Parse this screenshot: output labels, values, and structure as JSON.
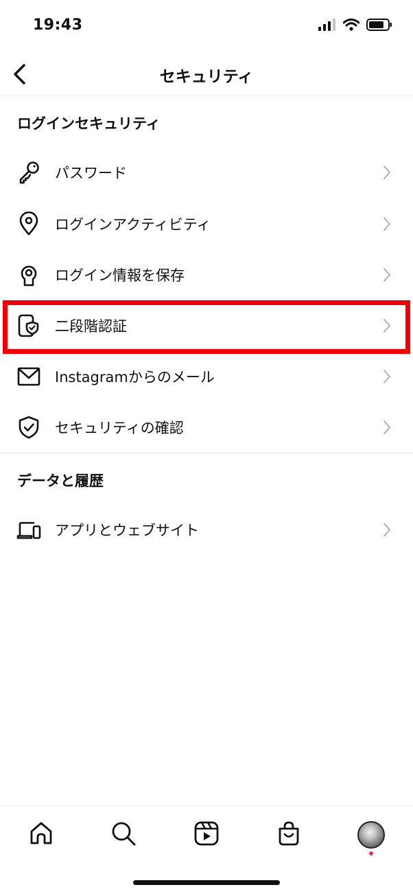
{
  "status_bar": {
    "time": "19:43",
    "icons": [
      "signal-icon",
      "wifi-icon",
      "battery-icon"
    ]
  },
  "header": {
    "title": "セキュリティ",
    "back_icon": "chevron-left-icon"
  },
  "sections": [
    {
      "title": "ログインセキュリティ",
      "items": [
        {
          "label": "パスワード",
          "icon": "key-icon"
        },
        {
          "label": "ログインアクティビティ",
          "icon": "location-pin-icon"
        },
        {
          "label": "ログイン情報を保存",
          "icon": "keyhole-icon"
        },
        {
          "label": "二段階認証",
          "icon": "device-shield-icon",
          "highlighted": true
        },
        {
          "label": "Instagramからのメール",
          "icon": "envelope-icon"
        },
        {
          "label": "セキュリティの確認",
          "icon": "shield-check-icon"
        }
      ]
    },
    {
      "title": "データと履歴",
      "items": [
        {
          "label": "アプリとウェブサイト",
          "icon": "devices-icon"
        }
      ]
    }
  ],
  "tab_bar": {
    "items": [
      "home-icon",
      "search-icon",
      "reels-icon",
      "shop-icon",
      "profile-avatar"
    ]
  },
  "colors": {
    "highlight": "#ee0000",
    "notification_dot": "#ff2d55",
    "chevron": "#b0b0b0"
  }
}
